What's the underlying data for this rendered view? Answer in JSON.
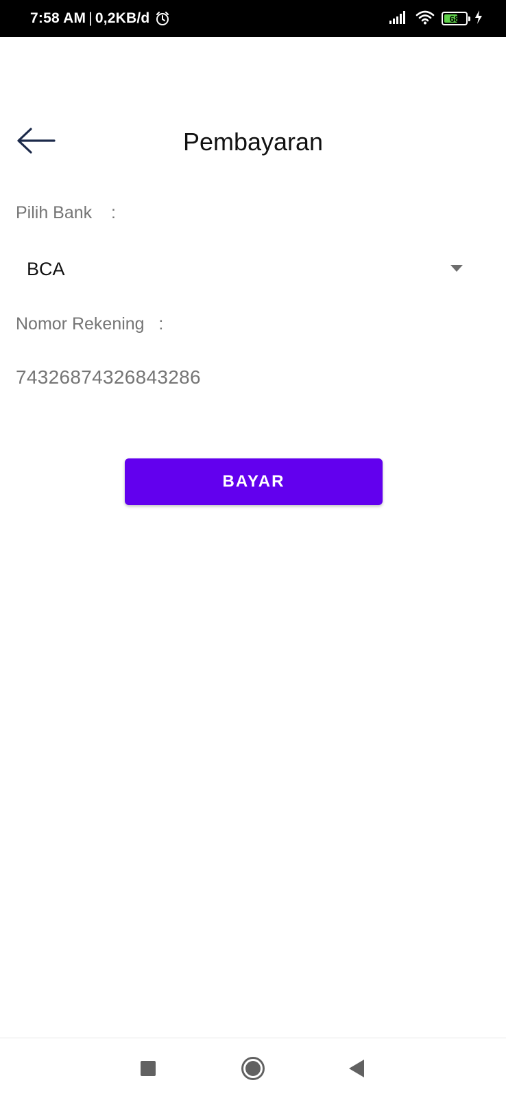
{
  "status_bar": {
    "time": "7:58 AM",
    "separator": "|",
    "data_rate": "0,2KB/d",
    "battery_level": "68",
    "battery_fraction": 0.68,
    "icons": [
      "alarm-icon",
      "signal-icon",
      "wifi-icon",
      "battery-icon",
      "charging-icon"
    ]
  },
  "header": {
    "title": "Pembayaran",
    "back_icon": "arrow-left-icon"
  },
  "form": {
    "bank_label": "Pilih Bank    :",
    "bank_selected": "BCA",
    "account_label": "Nomor Rekening   :",
    "account_number": "74326874326843286"
  },
  "actions": {
    "pay_label": "BAYAR"
  },
  "nav_bar": {
    "icons": [
      "recents-icon",
      "home-icon",
      "back-icon"
    ]
  },
  "colors": {
    "accent": "#6200ee",
    "status_bar_bg": "#000000",
    "label_text": "#757575",
    "title_text": "#111111",
    "battery_fill": "#5fd14a",
    "nav_icon": "#616161"
  }
}
